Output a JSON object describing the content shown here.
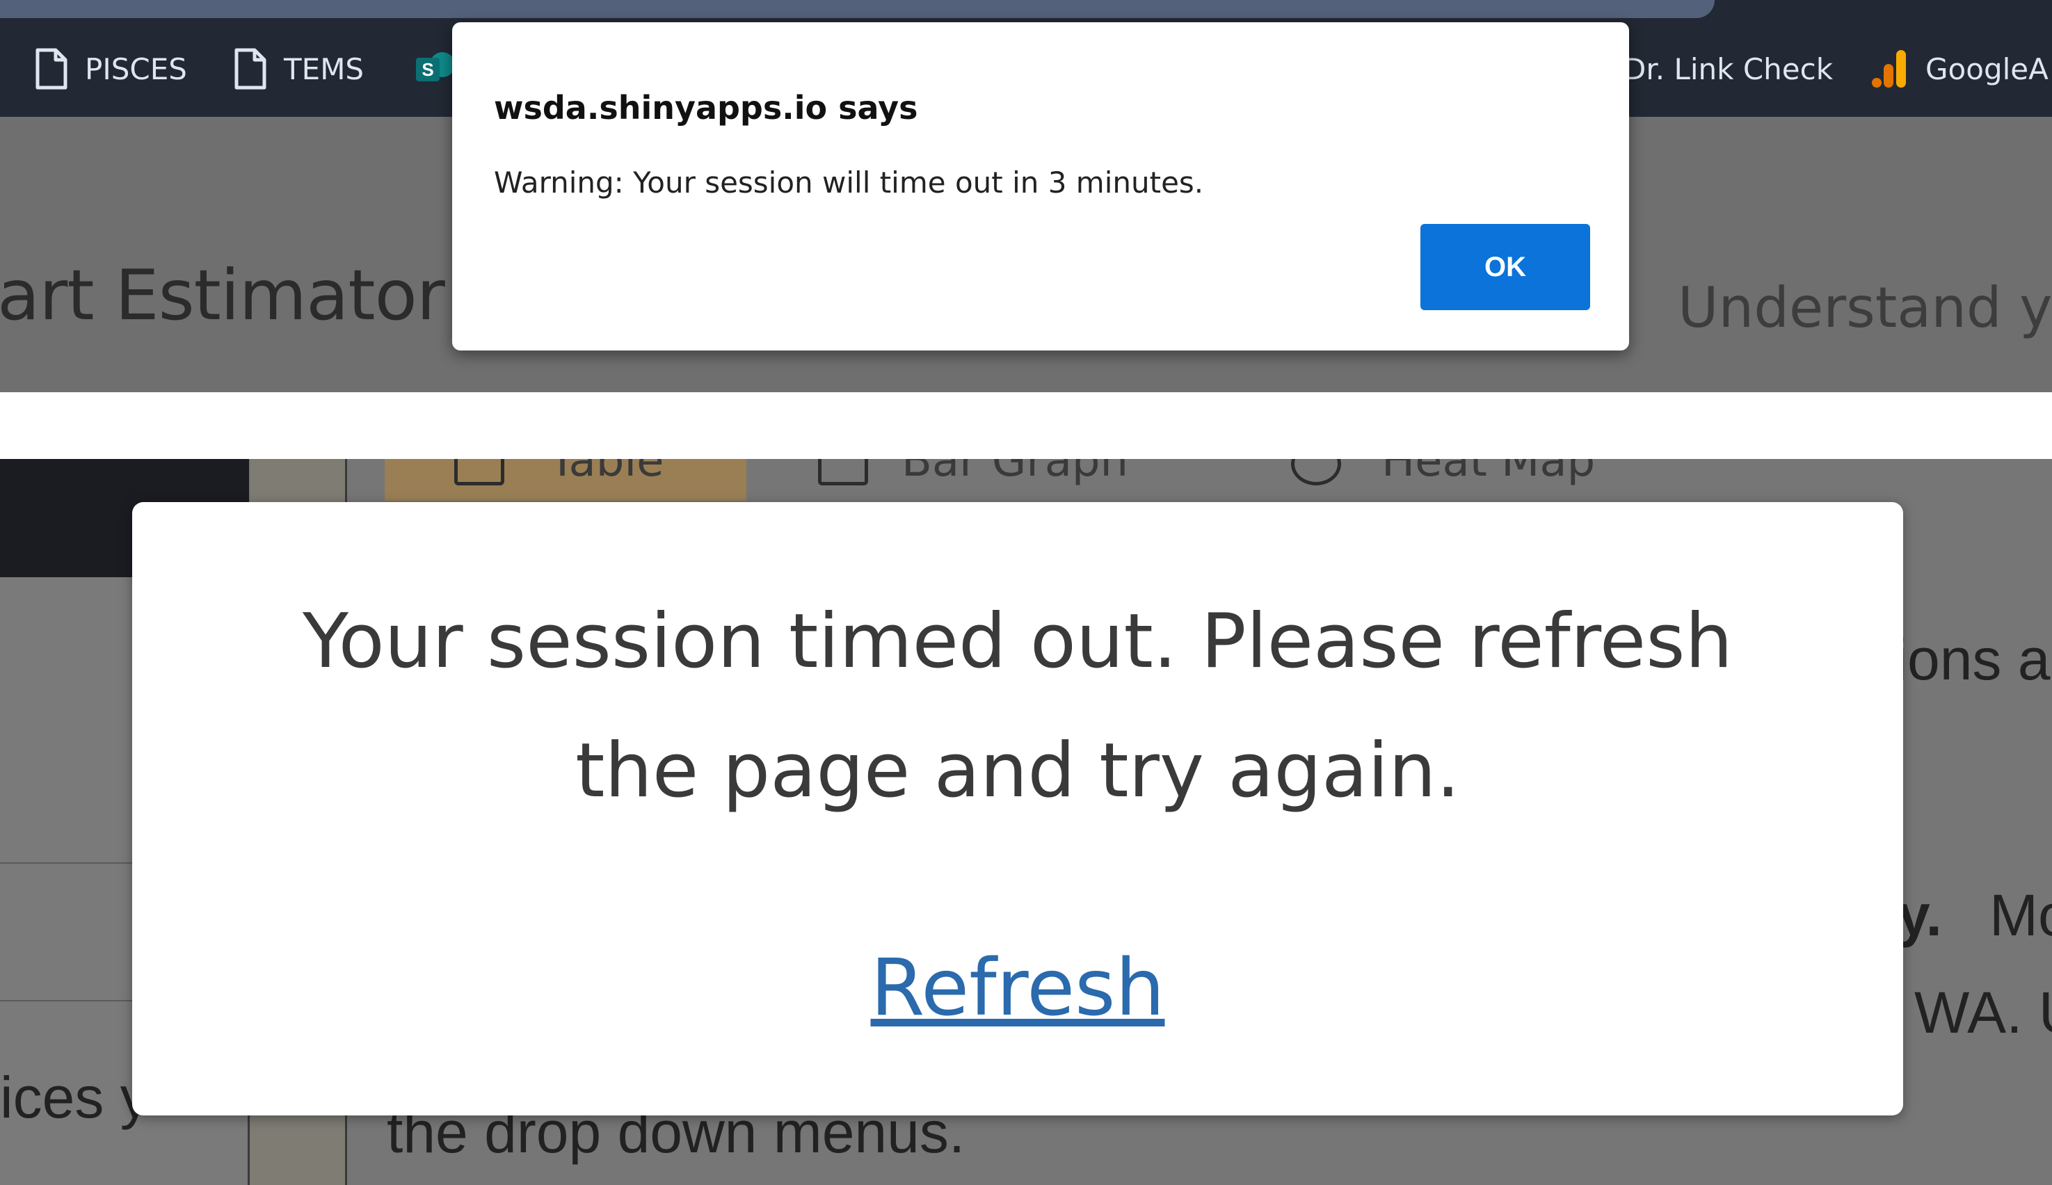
{
  "browser": {
    "bookmarks": [
      {
        "label": "PISCES",
        "icon": "page-icon"
      },
      {
        "label": "TEMS",
        "icon": "page-icon"
      },
      {
        "label": "S",
        "icon": "sharepoint-icon"
      },
      {
        "label": "Dr. Link Check",
        "icon": null
      },
      {
        "label": "GoogleA",
        "icon": "analytics-icon"
      }
    ]
  },
  "app": {
    "title": "art Estimator",
    "tagline": "Understand yo",
    "tabs": [
      "Table",
      "Bar Graph",
      "Heat Map"
    ],
    "bg_fragments": {
      "right_1": "tions a",
      "right_2_bold": "ty.",
      "right_2": " Mo",
      "right_3": "WA. U",
      "left": "ices y",
      "bottom": "the drop down menus."
    }
  },
  "alert": {
    "title": "wsda.shinyapps.io says",
    "message": "Warning: Your session will time out in 3 minutes.",
    "ok_label": "OK"
  },
  "modal": {
    "message": "Your session timed out. Please refresh the page and try again.",
    "link_label": "Refresh"
  },
  "colors": {
    "ok_button": "#0b73d9",
    "link": "#2a6aad",
    "bookmark_bar": "#222934",
    "overlay_gray": "#6f6f6f"
  }
}
